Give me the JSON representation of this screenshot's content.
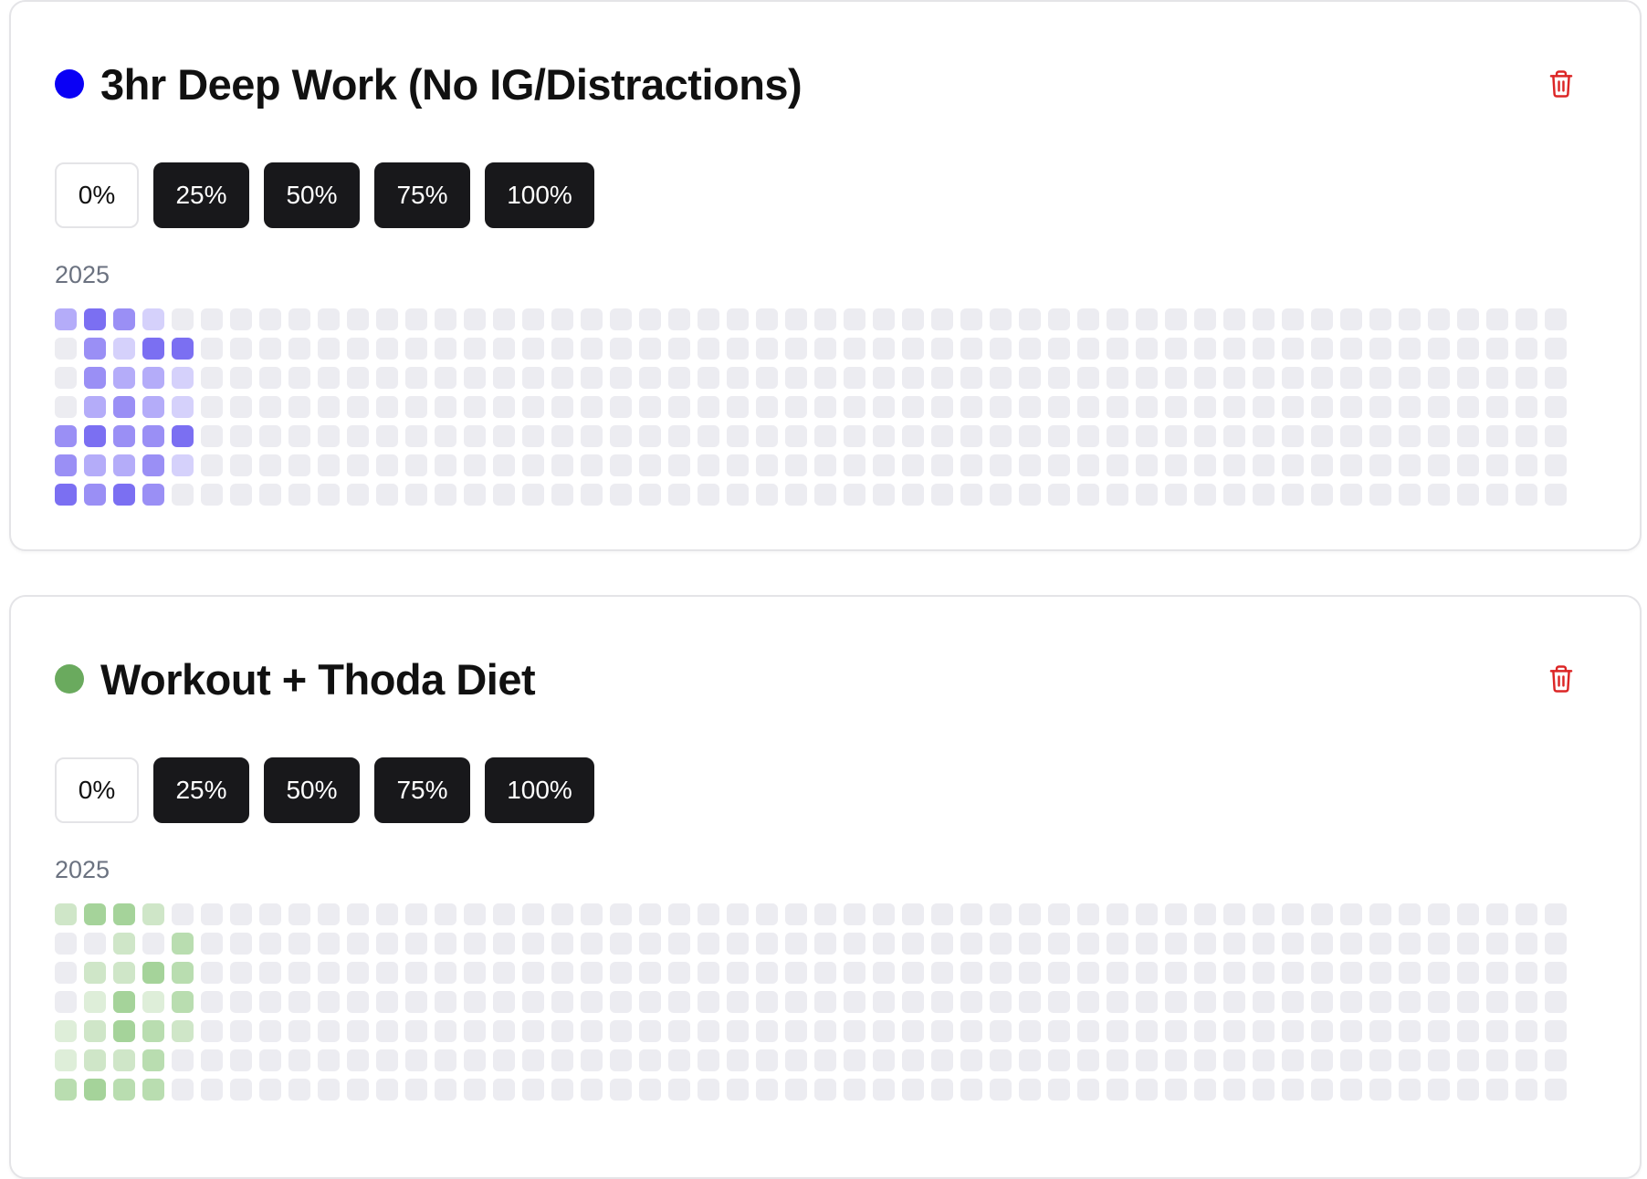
{
  "habits": [
    {
      "title": "3hr Deep Work (No IG/Distractions)",
      "color": "#0a00f5",
      "year": "2025",
      "levels": [
        "0%",
        "25%",
        "50%",
        "75%",
        "100%"
      ],
      "empty_color": "#ececf1",
      "palette": [
        "#ececf1",
        "#d5d1fb",
        "#b4acf9",
        "#9a8ff5",
        "#7b6ff2"
      ],
      "weeks": [
        [
          2,
          0,
          0,
          0,
          3,
          3,
          4
        ],
        [
          4,
          3,
          3,
          2,
          4,
          2,
          3
        ],
        [
          3,
          1,
          2,
          3,
          3,
          2,
          4
        ],
        [
          1,
          4,
          2,
          2,
          3,
          3,
          3
        ],
        [
          0,
          4,
          1,
          1,
          4,
          1,
          0
        ]
      ]
    },
    {
      "title": "Workout + Thoda Diet",
      "color": "#6aaa5e",
      "year": "2025",
      "levels": [
        "0%",
        "25%",
        "50%",
        "75%",
        "100%"
      ],
      "empty_color": "#ececf1",
      "palette": [
        "#ececf1",
        "#deeed9",
        "#cfe6c8",
        "#b9ddb0",
        "#a5d39a"
      ],
      "weeks": [
        [
          2,
          0,
          0,
          0,
          1,
          1,
          3
        ],
        [
          4,
          0,
          2,
          1,
          2,
          2,
          4
        ],
        [
          4,
          2,
          2,
          4,
          4,
          2,
          3
        ],
        [
          2,
          0,
          4,
          1,
          3,
          3,
          3
        ],
        [
          0,
          3,
          3,
          3,
          2,
          0,
          0
        ]
      ]
    }
  ]
}
